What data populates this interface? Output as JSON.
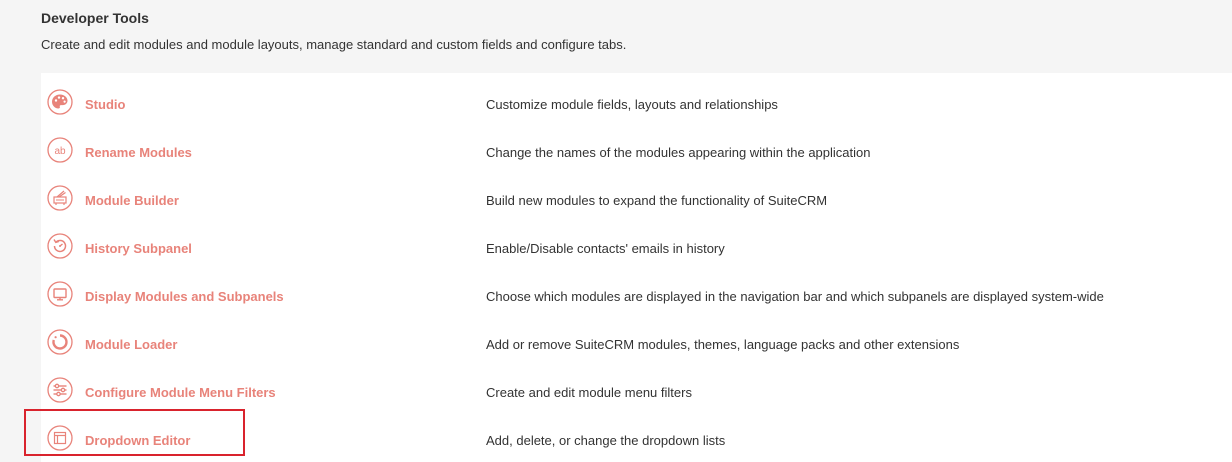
{
  "section": {
    "title": "Developer Tools",
    "description": "Create and edit modules and module layouts, manage standard and custom fields and configure tabs."
  },
  "accent_color": "#e8837a",
  "highlight_color": "#d9232d",
  "tools": [
    {
      "label": "Studio",
      "description": "Customize module fields, layouts and relationships",
      "icon": "palette-icon"
    },
    {
      "label": "Rename Modules",
      "description": "Change the names of the modules appearing within the application",
      "icon": "rename-icon",
      "icon_text": "ab"
    },
    {
      "label": "Module Builder",
      "description": "Build new modules to expand the functionality of SuiteCRM",
      "icon": "module-builder-icon"
    },
    {
      "label": "History Subpanel",
      "description": "Enable/Disable contacts' emails in history",
      "icon": "history-icon"
    },
    {
      "label": "Display Modules and Subpanels",
      "description": "Choose which modules are displayed in the navigation bar and which subpanels are displayed system-wide",
      "icon": "monitor-icon"
    },
    {
      "label": "Module Loader",
      "description": "Add or remove SuiteCRM modules, themes, language packs and other extensions",
      "icon": "module-loader-icon"
    },
    {
      "label": "Configure Module Menu Filters",
      "description": "Create and edit module menu filters",
      "icon": "filter-sliders-icon"
    },
    {
      "label": "Dropdown Editor",
      "description": "Add, delete, or change the dropdown lists",
      "icon": "dropdown-editor-icon"
    }
  ]
}
